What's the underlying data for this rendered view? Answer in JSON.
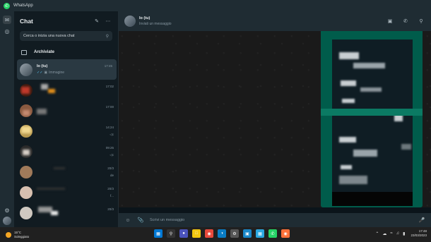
{
  "window": {
    "title": "WhatsApp"
  },
  "chatlist": {
    "title": "Chat",
    "search_placeholder": "Cerca o inizia una nuova chat",
    "archived_label": "Archiviate",
    "chats": [
      {
        "name": "Io (tu)",
        "preview": "Immagine",
        "time": "17:45",
        "mark": ""
      },
      {
        "name": "",
        "preview": "",
        "time": "17:02",
        "mark": ""
      },
      {
        "name": "",
        "preview": "",
        "time": "17:00",
        "mark": ""
      },
      {
        "name": "",
        "preview": "",
        "time": "14:24",
        "mark": "◁ϲ"
      },
      {
        "name": "",
        "preview": "",
        "time": "09:25",
        "mark": "◁ϲ"
      },
      {
        "name": "",
        "preview": "",
        "time": "20/3",
        "mark": "de"
      },
      {
        "name": "",
        "preview": "",
        "time": "20/3",
        "mark": "f..."
      },
      {
        "name": "",
        "preview": "",
        "time": "20/3",
        "mark": ""
      },
      {
        "name": "",
        "preview": "",
        "time": "20/3",
        "mark": ""
      }
    ]
  },
  "conversation": {
    "name": "Io (tu)",
    "status": "Inviati un messaggio",
    "composer_placeholder": "Scrivi un messaggio"
  },
  "taskbar": {
    "temperature": "15°C",
    "weather": "Soleggiato",
    "time": "17:48",
    "date": "23/03/2023"
  },
  "icons": {
    "rail_chats": "chat-bubble-icon",
    "rail_status": "status-icon",
    "rail_settings": "gear-icon"
  },
  "colors": {
    "accent": "#25d366",
    "bubble": "#005c4b",
    "panel": "#1f2c33"
  }
}
